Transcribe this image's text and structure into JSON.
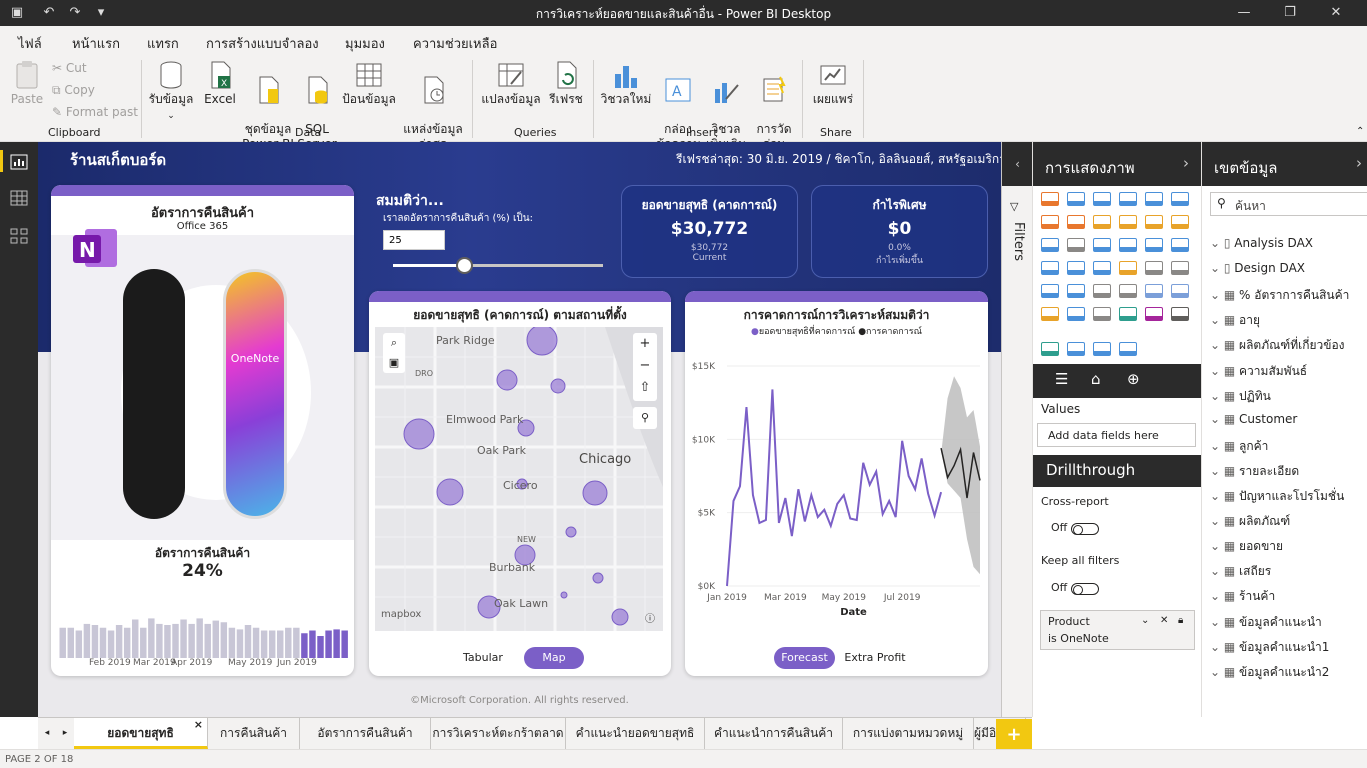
{
  "window": {
    "title": "การวิเคราะห์ยอดขายและสินค้าอื่น - Power BI Desktop"
  },
  "menu": {
    "items": [
      "ไฟล์",
      "หน้าแรก",
      "แทรก",
      "การสร้างแบบจำลอง",
      "มุมมอง",
      "ความช่วยเหลือ"
    ]
  },
  "ribbon": {
    "clipboard": {
      "paste": "Paste",
      "cut": "Cut",
      "copy": "Copy",
      "format": "Format past",
      "group": "Clipboard"
    },
    "data": {
      "get": "รับข้อมูล",
      "excel": "Excel",
      "pbi": "ชุดข้อมูล\nPower BI",
      "sql": "SQL\nServer",
      "enter": "ป้อนข้อมูล",
      "recent": "แหล่งข้อมูล\nล่าสุด",
      "group": "Data"
    },
    "queries": {
      "transform": "แปลงข้อมูล",
      "refresh": "รีเฟรช",
      "group": "Queries"
    },
    "insert": {
      "visual": "วิชวลใหม่",
      "textbox": "กล่อง\nข้อความ",
      "more": "วิชวล\nเพิ่มเติม",
      "quick": "การวัด\nด่วน",
      "group": "Insert"
    },
    "share": {
      "publish": "เผยแพร่",
      "group": "Share"
    }
  },
  "report": {
    "title": "ร้านสเก็ตบอร์ด",
    "refresh": "รีเฟรชล่าสุด: 30 มิ.ย. 2019 / ชิคาโก, อิลลินอยส์, สหรัฐอเมริกา",
    "product_card": {
      "title": "อัตราการคืนสินค้า",
      "subtitle": "Office 365",
      "onenote": "OneNote",
      "rate_label": "อัตราการคืนสินค้า",
      "rate_value": "24%",
      "months": [
        "Feb 2019",
        "Mar 2019",
        "Apr 2019",
        "May 2019",
        "Jun 2019"
      ],
      "bars": [
        0.55,
        0.55,
        0.5,
        0.62,
        0.6,
        0.55,
        0.5,
        0.6,
        0.55,
        0.7,
        0.55,
        0.72,
        0.62,
        0.6,
        0.62,
        0.7,
        0.62,
        0.72,
        0.62,
        0.68,
        0.65,
        0.55,
        0.52,
        0.6,
        0.55,
        0.5,
        0.5,
        0.5,
        0.55,
        0.55,
        0.45,
        0.5,
        0.4,
        0.5,
        0.52,
        0.5
      ]
    },
    "whatif": {
      "title": "สมมติว่า...",
      "label": "เราลดอัตราการคืนสินค้า (%) เป็น:",
      "value": "25",
      "slider": 0.34
    },
    "kpi1": {
      "title": "ยอดขายสุทธิ (คาดการณ์)",
      "value": "$30,772",
      "sub1": "$30,772",
      "sub2": "Current"
    },
    "kpi2": {
      "title": "กำไรพิเศษ",
      "value": "$0",
      "sub1": "0.0%",
      "sub2": "กำไรเพิ่มขึ้น"
    },
    "map": {
      "title": "ยอดขายสุทธิ (คาดการณ์) ตามสถานที่ตั้ง",
      "places": [
        "Park Ridge",
        "Elmwood Park",
        "Oak Park",
        "Chicago",
        "Cicero",
        "Burbank",
        "Oak Lawn",
        "DRO",
        "NEW"
      ],
      "logo": "mapbox",
      "btn1": "Tabular",
      "btn2": "Map"
    },
    "forecast": {
      "title": "การคาดการณ์การวิเคราะห์สมมติว่า",
      "legend1": "ยอดขายสุทธิที่คาดการณ์",
      "legend2": "การคาดการณ์",
      "xlabel": "Date",
      "btn1": "Forecast",
      "btn2": "Extra Profit"
    },
    "footer": "©Microsoft Corporation. All rights reserved."
  },
  "chart_data": {
    "type": "line",
    "title": "การคาดการณ์การวิเคราะห์สมมติว่า",
    "xlabel": "Date",
    "ylabel": "",
    "x_ticks": [
      "Jan 2019",
      "Mar 2019",
      "May 2019",
      "Jul 2019"
    ],
    "y_ticks": [
      "$0K",
      "$5K",
      "$10K",
      "$15K"
    ],
    "ylim": [
      0,
      15000
    ],
    "series": [
      {
        "name": "ยอดขายสุทธิที่คาดการณ์",
        "values": [
          0,
          5800,
          6800,
          12200,
          6200,
          4300,
          4500,
          13400,
          4300,
          6000,
          3400,
          6600,
          4400,
          6200,
          4700,
          5200,
          4100,
          5600,
          6200,
          4600,
          4500,
          8400,
          6900,
          7800,
          4900,
          5800,
          4700,
          9900,
          7500,
          6600,
          8700,
          6300,
          4800,
          6400
        ]
      },
      {
        "name": "การคาดการณ์",
        "values": [
          9400,
          7400,
          8200,
          9300,
          6000,
          9100,
          7200
        ]
      }
    ],
    "band_upper": [
      9000,
      12800,
      14300,
      13500,
      11500,
      12000,
      9500
    ],
    "band_lower": [
      9200,
      7000,
      6500,
      6000,
      3200,
      1300,
      800
    ]
  },
  "panes": {
    "filters": "Filters",
    "viz": "การแสดงภาพ",
    "fields": "เขตข้อมูล",
    "values": "Values",
    "add_fields": "Add data fields here",
    "drill": "Drillthrough",
    "cross": "Cross-report",
    "off1": "Off",
    "keep": "Keep all filters",
    "off2": "Off",
    "filter_field": "Product",
    "filter_value": "is OneNote",
    "search": "ค้นหา"
  },
  "field_list": [
    "Analysis DAX",
    "Design DAX",
    "% อัตราการคืนสินค้า",
    "อายุ",
    "ผลิตภัณฑ์ที่เกี่ยวข้อง",
    "ความสัมพันธ์",
    "ปฏิทิน",
    "Customer",
    "ลูกค้า",
    "รายละเอียด",
    "ปัญหาและโปรโมชั่น",
    "ผลิตภัณฑ์",
    "ยอดขาย",
    "เสถียร",
    "ร้านค้า",
    "ข้อมูลคำแนะนำ",
    "ข้อมูลคำแนะนำ1",
    "ข้อมูลคำแนะนำ2"
  ],
  "tabs": [
    "ยอดขายสุทธิ",
    "การคืนสินค้า",
    "อัตราการคืนสินค้า",
    "การวิเคราะห์ตะกร้าตลาด",
    "คำแนะนำยอดขายสุทธิ",
    "คำแนะนำการคืนสินค้า",
    "การแบ่งตามหมวดหมู่",
    "ผู้มีอิทธิพล"
  ],
  "status": "PAGE 2 OF 18"
}
